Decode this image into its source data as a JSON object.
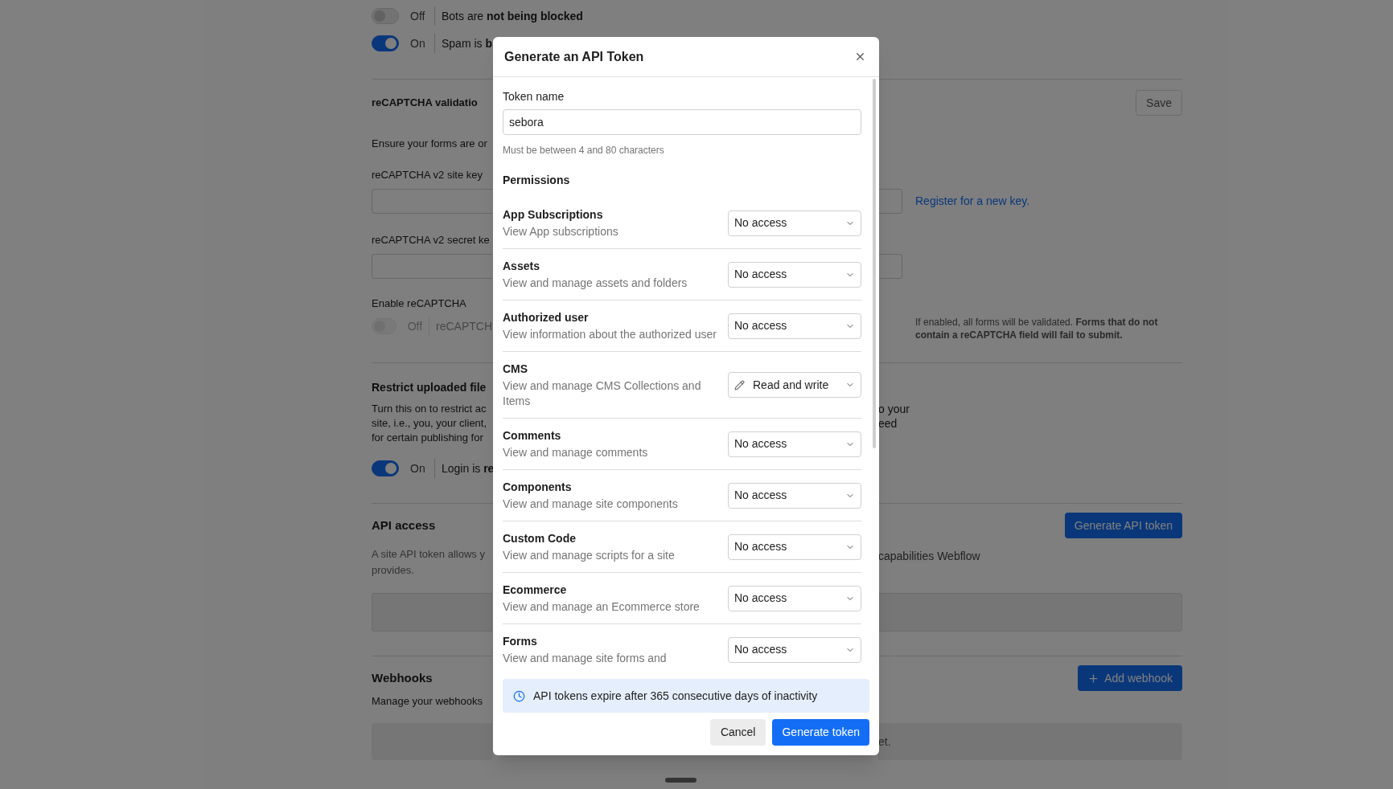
{
  "background": {
    "bot_toggles": [
      {
        "on": false,
        "disabled": false,
        "label": "Off",
        "text": "Bots are **not being blocked**"
      },
      {
        "on": true,
        "disabled": false,
        "label": "On",
        "text": "Spam is **b**"
      }
    ],
    "recaptcha": {
      "title": "reCAPTCHA validatio",
      "save_button": "Save",
      "description": "Ensure your forms are or",
      "site_key_label": "reCAPTCHA v2 site key",
      "register_link": "Register for a new key.",
      "secret_key_label": "reCAPTCHA v2 secret ke",
      "enable_label": "Enable reCAPTCHA",
      "toggle": {
        "on": false,
        "disabled": true,
        "label": "Off",
        "text": "reCAPTCH"
      },
      "note": "If enabled, all forms will be validated. **Forms that do not contain a reCAPTCHA field will fail to submit.**"
    },
    "restrict": {
      "title": "Restrict uploaded file",
      "lines_left": [
        "Turn this on to restrict ac",
        "site, i.e., you, your client,",
        "for certain publishing for"
      ],
      "lines_right": [
        "o your",
        "eed"
      ],
      "toggle": {
        "on": true,
        "disabled": false,
        "label": "On",
        "text": "Login is **re**"
      }
    },
    "api_access": {
      "title": "API access",
      "button": "Generate API token",
      "lines_left": [
        "A site API token allows y",
        "provides."
      ],
      "line_right": "capabilities Webflow"
    },
    "webhooks": {
      "title": "Webhooks",
      "button": "Add webhook",
      "description": "Manage your webhooks",
      "panel_text": "et."
    }
  },
  "modal": {
    "title": "Generate an API Token",
    "token_label": "Token name",
    "token_value": "sebora",
    "token_hint": "Must be between 4 and 80 characters",
    "permissions_title": "Permissions",
    "permissions": [
      {
        "name": "App Subscriptions",
        "description": "View App subscriptions",
        "value": "No access",
        "kind": "none"
      },
      {
        "name": "Assets",
        "description": "View and manage assets and folders",
        "value": "No access",
        "kind": "none"
      },
      {
        "name": "Authorized user",
        "description": "View information about the authorized user",
        "value": "No access",
        "kind": "none"
      },
      {
        "name": "CMS",
        "description": "View and manage CMS Collections and Items",
        "value": "Read and write",
        "kind": "write"
      },
      {
        "name": "Comments",
        "description": "View and manage comments",
        "value": "No access",
        "kind": "none"
      },
      {
        "name": "Components",
        "description": "View and manage site components",
        "value": "No access",
        "kind": "none"
      },
      {
        "name": "Custom Code",
        "description": "View and manage scripts for a site",
        "value": "No access",
        "kind": "none"
      },
      {
        "name": "Ecommerce",
        "description": "View and manage an Ecommerce store",
        "value": "No access",
        "kind": "none"
      },
      {
        "name": "Forms",
        "description": "View and manage site forms and",
        "value": "No access",
        "kind": "none"
      }
    ],
    "notice": "API tokens expire after 365 consecutive days of inactivity",
    "cancel_button": "Cancel",
    "generate_button": "Generate token"
  }
}
